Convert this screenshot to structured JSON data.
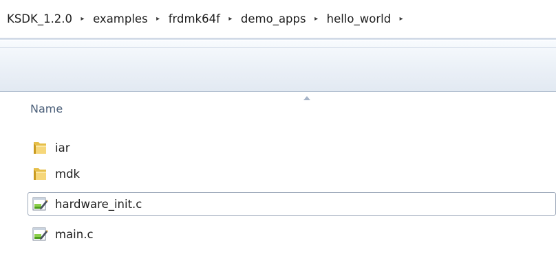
{
  "breadcrumb": {
    "items": [
      "KSDK_1.2.0",
      "examples",
      "frdmk64f",
      "demo_apps",
      "hello_world"
    ],
    "separator": "▸"
  },
  "columns": {
    "name": "Name",
    "sort": "ascending"
  },
  "files": [
    {
      "name": "iar",
      "type": "folder",
      "icon": "folder-icon"
    },
    {
      "name": "mdk",
      "type": "folder",
      "icon": "folder-icon"
    },
    {
      "name": "hardware_init.c",
      "type": "file",
      "icon": "c-source-file-icon",
      "focused": true
    },
    {
      "name": "main.c",
      "type": "file",
      "icon": "c-source-file-icon"
    }
  ],
  "colors": {
    "header_text": "#4c607a",
    "focus_border": "#9aa6b8",
    "commandbar_top": "#f8fbfe",
    "commandbar_bottom": "#e2e9f2"
  }
}
